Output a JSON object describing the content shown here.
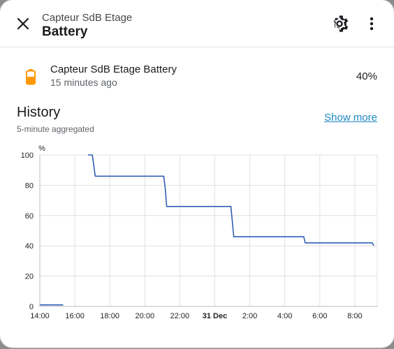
{
  "header": {
    "subtitle": "Capteur SdB Etage",
    "title": "Battery",
    "close_icon": "close-icon",
    "settings_icon": "gear-icon",
    "menu_icon": "more-vertical-icon"
  },
  "entity": {
    "name": "Capteur SdB Etage Battery",
    "last_changed": "15 minutes ago",
    "state": "40%",
    "icon": "battery-icon",
    "icon_color": "#ff9800"
  },
  "history": {
    "title": "History",
    "show_more": "Show more",
    "note": "5-minute aggregated"
  },
  "colors": {
    "accent": "#1e88c5",
    "line": "#2f5fb3",
    "battery": "#ff9800"
  },
  "chart_data": {
    "type": "line",
    "ylabel": "%",
    "ylim": [
      0,
      100
    ],
    "yticks": [
      "0",
      "20",
      "40",
      "60",
      "80",
      "100"
    ],
    "xticks": [
      "14:00",
      "16:00",
      "18:00",
      "20:00",
      "22:00",
      "31 Dec",
      "2:00",
      "4:00",
      "6:00",
      "8:00"
    ],
    "xticks_bold": [
      false,
      false,
      false,
      false,
      false,
      true,
      false,
      false,
      false,
      false
    ],
    "grid": true,
    "series": [
      {
        "points": [
          [
            "14:00",
            1
          ],
          [
            "15:20",
            1
          ]
        ]
      },
      {
        "points": [
          [
            "16:45",
            100
          ],
          [
            "17:00",
            100
          ],
          [
            "17:10",
            86
          ],
          [
            "21:05",
            86
          ],
          [
            "21:10",
            78
          ],
          [
            "21:15",
            66
          ],
          [
            "0:55",
            66
          ],
          [
            "1:00",
            56
          ],
          [
            "1:05",
            46
          ],
          [
            "5:05",
            46
          ],
          [
            "5:10",
            42
          ],
          [
            "9:00",
            42
          ],
          [
            "9:05",
            40
          ]
        ]
      }
    ]
  }
}
